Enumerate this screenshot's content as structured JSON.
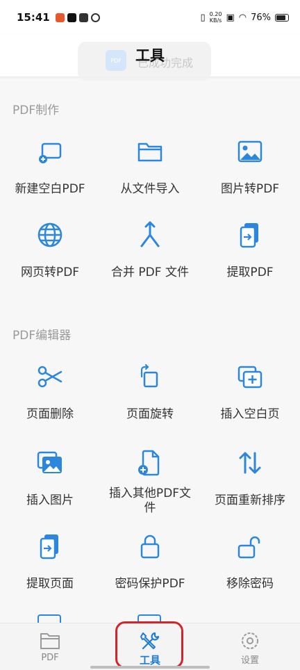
{
  "status": {
    "time": "15:41",
    "netspeed_value": "0.20",
    "netspeed_unit": "KB/s",
    "battery": "76%"
  },
  "toast": {
    "icon_text": "PDF",
    "text": "已成功完成"
  },
  "header": {
    "title": "工具"
  },
  "sections": [
    {
      "title": "PDF制作",
      "tools": [
        {
          "label": "新建空白PDF",
          "icon": "new-blank-pdf-icon"
        },
        {
          "label": "从文件导入",
          "icon": "folder-icon"
        },
        {
          "label": "图片转PDF",
          "icon": "image-icon"
        },
        {
          "label": "网页转PDF",
          "icon": "globe-icon"
        },
        {
          "label": "合并 PDF 文件",
          "icon": "merge-icon"
        },
        {
          "label": "提取PDF",
          "icon": "extract-icon"
        }
      ]
    },
    {
      "title": "PDF编辑器",
      "tools": [
        {
          "label": "页面删除",
          "icon": "scissors-icon"
        },
        {
          "label": "页面旋转",
          "icon": "rotate-icon"
        },
        {
          "label": "插入空白页",
          "icon": "insert-page-icon"
        },
        {
          "label": "插入图片",
          "icon": "insert-image-icon"
        },
        {
          "label": "插入其他PDF文件",
          "icon": "insert-file-icon"
        },
        {
          "label": "页面重新排序",
          "icon": "reorder-icon"
        },
        {
          "label": "提取页面",
          "icon": "extract-pages-icon"
        },
        {
          "label": "密码保护PDF",
          "icon": "lock-icon"
        },
        {
          "label": "移除密码",
          "icon": "unlock-icon"
        }
      ]
    }
  ],
  "tabs": [
    {
      "label": "PDF",
      "icon": "folder-icon",
      "active": false
    },
    {
      "label": "工具",
      "icon": "tools-icon",
      "active": true
    },
    {
      "label": "设置",
      "icon": "gear-icon",
      "active": false
    }
  ],
  "colors": {
    "accent": "#2b87dd",
    "highlight": "#d0252b",
    "background": "#f7f7f7"
  }
}
